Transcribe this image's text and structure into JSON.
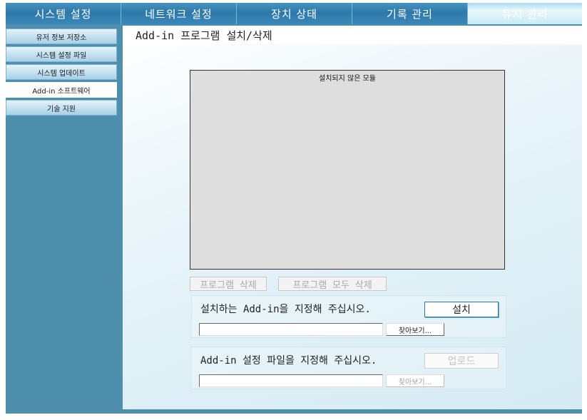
{
  "topnav": {
    "tabs": [
      {
        "label": "시스템 설정"
      },
      {
        "label": "네트워크 설정"
      },
      {
        "label": "장치 상태"
      },
      {
        "label": "기록 관리"
      },
      {
        "label": "유지 관리"
      }
    ],
    "active_index": 4
  },
  "sidebar": {
    "items": [
      {
        "label": "유저 정보 저장소"
      },
      {
        "label": "시스템 설정 파일"
      },
      {
        "label": "시스템 업데이트"
      },
      {
        "label": "Add-in 소프트웨어"
      },
      {
        "label": "기술 지원"
      }
    ],
    "active_index": 3
  },
  "main": {
    "title": "Add-in 프로그램 설치/삭제",
    "module_list": {
      "header": "설치되지 않은 모듈"
    },
    "delete_button_label": "프로그램 삭제",
    "delete_all_button_label": "프로그램 모두 삭제",
    "install_group": {
      "label": "설치하는 Add-in을 지정해 주십시오.",
      "action_label": "설치",
      "file_value": "",
      "browse_label": "찾아보기..."
    },
    "upload_group": {
      "label": "Add-in 설정 파일을 지정해 주십시오.",
      "action_label": "업로드",
      "file_value": "",
      "browse_label": "찾아보기..."
    }
  },
  "colors": {
    "frame_blue": "#4f8fae",
    "tab_blue": "#2e78a8",
    "tab_active": "#c9ebf6",
    "accent_border": "#2e78a8"
  }
}
